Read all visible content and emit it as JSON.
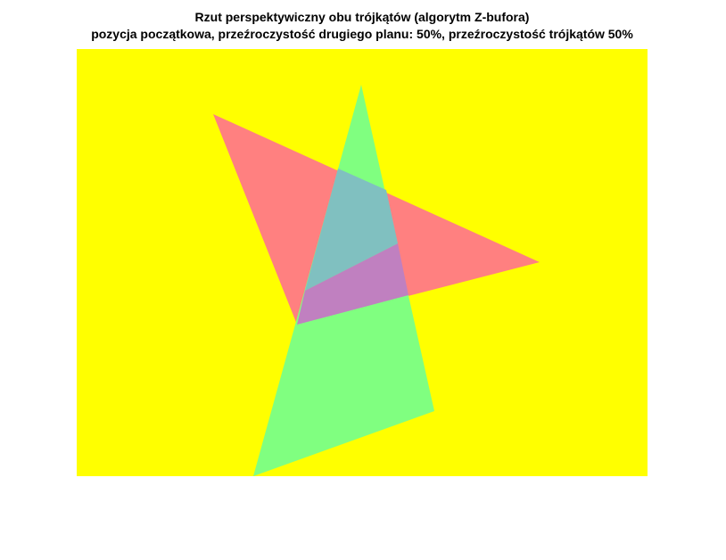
{
  "figure": {
    "title_line1": "Rzut perspektywiczny obu trójkątów (algorytm Z-bufora)",
    "title_line2": "pozycja początkowa, przeźroczystość drugiego planu: 50%, przeźroczystość trójkątów 50%"
  },
  "colors": {
    "background_plane": "#FFFF00",
    "red_triangle": "#FF8080",
    "green_triangle": "#80FF80",
    "overlap_over_red": "#80C0C0",
    "overlap_over_green": "#C080C0"
  }
}
